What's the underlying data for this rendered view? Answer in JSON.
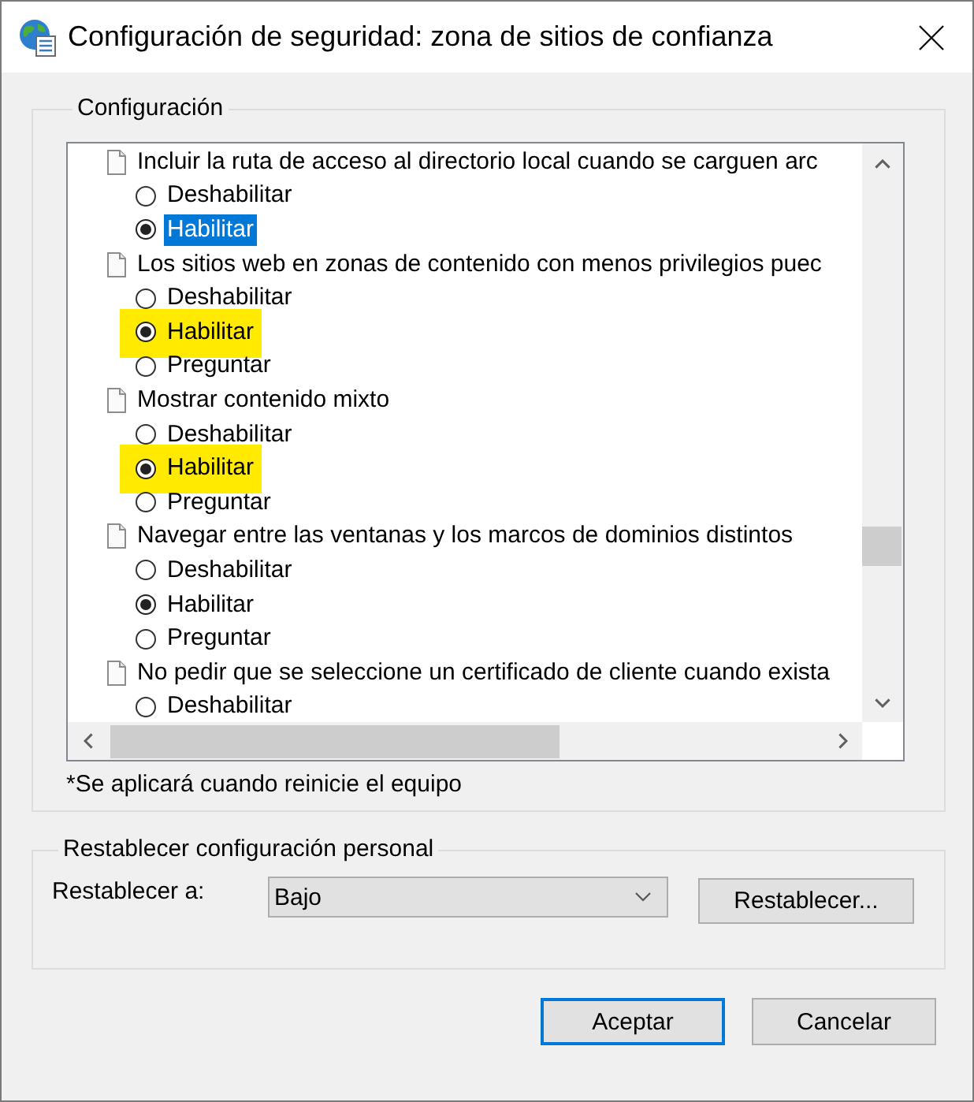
{
  "window": {
    "title": "Configuración de seguridad: zona de sitios de confianza"
  },
  "settings": {
    "legend": "Configuración",
    "items": [
      {
        "label": "Incluir la ruta de acceso al directorio local cuando se carguen arc",
        "options": [
          {
            "label": "Deshabilitar",
            "checked": false,
            "selected": false,
            "highlighted": false
          },
          {
            "label": "Habilitar",
            "checked": true,
            "selected": true,
            "highlighted": false
          }
        ]
      },
      {
        "label": "Los sitios web en zonas de contenido con menos privilegios puec",
        "options": [
          {
            "label": "Deshabilitar",
            "checked": false,
            "selected": false,
            "highlighted": false
          },
          {
            "label": "Habilitar",
            "checked": true,
            "selected": false,
            "highlighted": true
          },
          {
            "label": "Preguntar",
            "checked": false,
            "selected": false,
            "highlighted": false
          }
        ]
      },
      {
        "label": "Mostrar contenido mixto",
        "options": [
          {
            "label": "Deshabilitar",
            "checked": false,
            "selected": false,
            "highlighted": false
          },
          {
            "label": "Habilitar",
            "checked": true,
            "selected": false,
            "highlighted": true
          },
          {
            "label": "Preguntar",
            "checked": false,
            "selected": false,
            "highlighted": false
          }
        ]
      },
      {
        "label": "Navegar entre las ventanas y los marcos de dominios distintos",
        "options": [
          {
            "label": "Deshabilitar",
            "checked": false,
            "selected": false,
            "highlighted": false
          },
          {
            "label": "Habilitar",
            "checked": true,
            "selected": false,
            "highlighted": false
          },
          {
            "label": "Preguntar",
            "checked": false,
            "selected": false,
            "highlighted": false
          }
        ]
      },
      {
        "label": "No pedir que se seleccione un certificado de cliente cuando exista",
        "options": [
          {
            "label": "Deshabilitar",
            "checked": false,
            "selected": false,
            "highlighted": false
          }
        ]
      }
    ],
    "note": "*Se aplicará cuando reinicie el equipo"
  },
  "reset": {
    "legend": "Restablecer configuración personal",
    "label": "Restablecer a:",
    "dropdown": {
      "value": "Bajo"
    },
    "button": "Restablecer..."
  },
  "buttons": [
    {
      "label": "Aceptar",
      "default": true
    },
    {
      "label": "Cancelar",
      "default": false
    }
  ]
}
